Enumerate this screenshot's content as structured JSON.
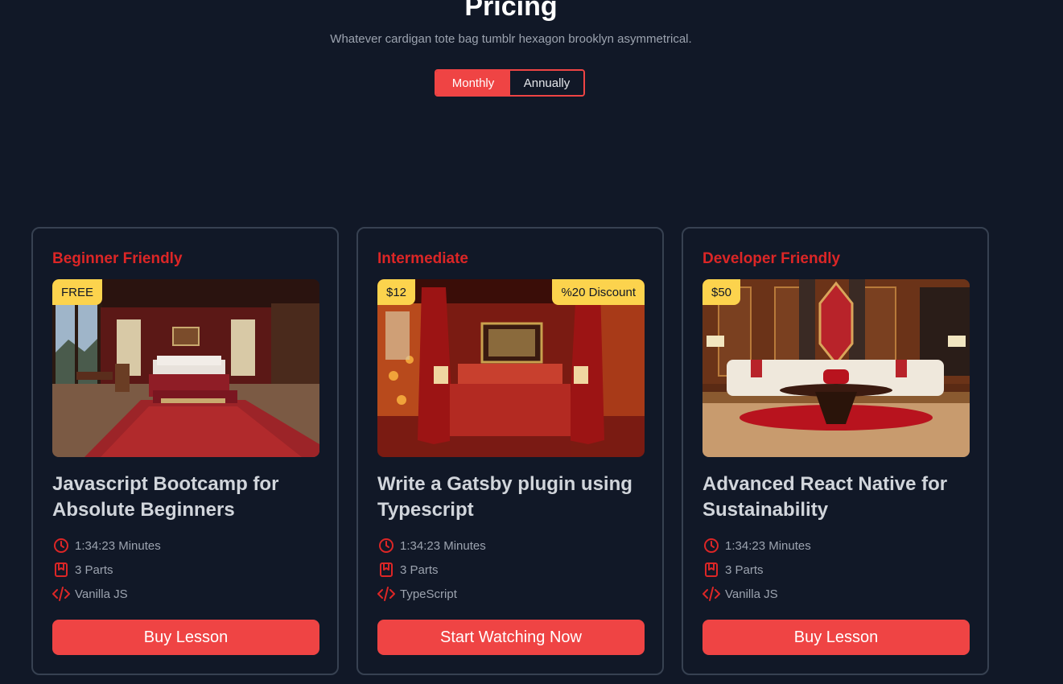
{
  "header": {
    "title": "Pricing",
    "subtitle": "Whatever cardigan tote bag tumblr hexagon brooklyn asymmetrical."
  },
  "billing_toggle": {
    "monthly_label": "Monthly",
    "annually_label": "Annually",
    "selected": "Monthly"
  },
  "colors": {
    "accent": "#ef4444",
    "badge": "#fcd34d",
    "background": "#111827"
  },
  "cards": [
    {
      "level": "Beginner Friendly",
      "price_badge": "FREE",
      "discount_badge": "",
      "title": "Javascript Bootcamp for Absolute Beginners",
      "duration": "1:34:23 Minutes",
      "parts": "3 Parts",
      "tech": "Vanilla JS",
      "cta": "Buy Lesson",
      "image": "bedroom-photo"
    },
    {
      "level": "Intermediate",
      "price_badge": "$12",
      "discount_badge": "%20 Discount",
      "title": "Write a Gatsby plugin using Typescript",
      "duration": "1:34:23 Minutes",
      "parts": "3 Parts",
      "tech": "TypeScript",
      "cta": "Start Watching Now",
      "image": "red-bedroom-photo"
    },
    {
      "level": "Developer Friendly",
      "price_badge": "$50",
      "discount_badge": "",
      "title": "Advanced React Native for Sustainability",
      "duration": "1:34:23 Minutes",
      "parts": "3 Parts",
      "tech": "Vanilla JS",
      "cta": "Buy Lesson",
      "image": "lounge-photo"
    }
  ],
  "icons": {
    "duration": "clock-icon",
    "parts": "bookmark-icon",
    "tech": "code-icon"
  }
}
